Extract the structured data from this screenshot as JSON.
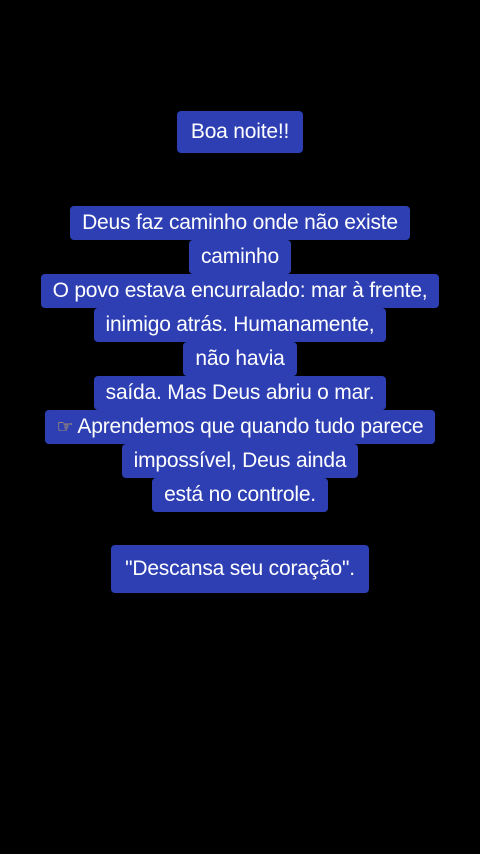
{
  "greeting": "Boa noite!!",
  "message_lines": [
    "Deus faz caminho onde não existe",
    "caminho",
    "O povo estava encurralado: mar à frente,",
    "inimigo atrás. Humanamente,",
    "não havia",
    "saída. Mas Deus abriu o mar.",
    "Aprendemos que quando tudo parece",
    "impossível, Deus ainda",
    "está no controle."
  ],
  "quote": "\"Descansa seu coração\".",
  "icons": {
    "pointing_hand": "pointing-right-hand-emoji"
  },
  "colors": {
    "background": "#000000",
    "highlight": "#2d3fb3",
    "text": "#ffffff"
  }
}
